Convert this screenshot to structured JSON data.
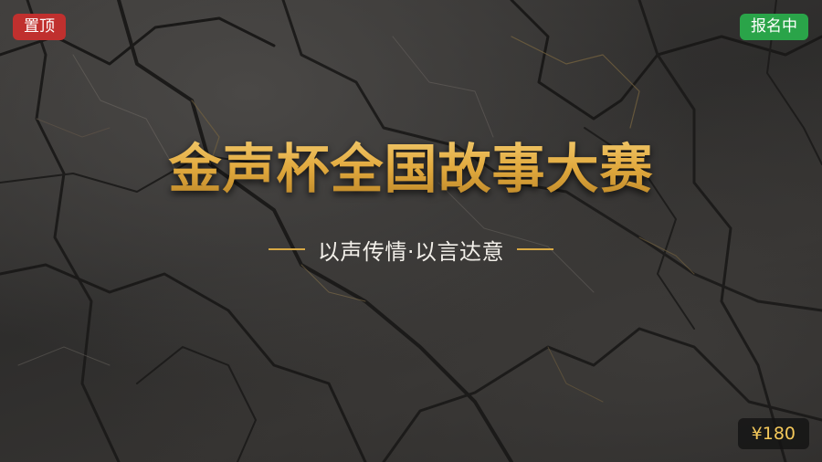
{
  "badges": {
    "pinned": "置顶",
    "status": "报名中"
  },
  "event": {
    "title": "金声杯全国故事大赛",
    "subtitle": "以声传情·以言达意",
    "price": "¥180"
  },
  "colors": {
    "pinned_badge": "#c0302e",
    "status_badge": "#2aa449",
    "title_gold": "#e6b54a",
    "price_text": "#f4c85a"
  }
}
